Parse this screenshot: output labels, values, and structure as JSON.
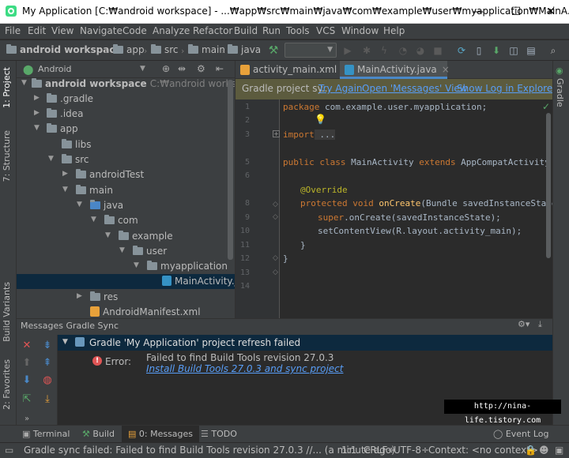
{
  "window": {
    "title": "My Application [C:₩android workspace] - ...₩app₩src₩main₩java₩com₩example₩user₩myapplication₩MainA...",
    "minimize": "—",
    "maximize": "☐",
    "close": "✕"
  },
  "menu": [
    "File",
    "Edit",
    "View",
    "Navigate",
    "Code",
    "Analyze",
    "Refactor",
    "Build",
    "Run",
    "Tools",
    "VCS",
    "Window",
    "Help"
  ],
  "breadcrumb": [
    "android workspace",
    "app",
    "src",
    "main",
    "java"
  ],
  "project_panel": {
    "view_mode": "Android",
    "tree": [
      {
        "label": "android workspace",
        "extra": "C:₩android workspace",
        "arrow": "▼"
      },
      {
        "label": ".gradle",
        "arrow": "▶"
      },
      {
        "label": ".idea",
        "arrow": "▶"
      },
      {
        "label": "app",
        "arrow": "▼"
      },
      {
        "label": "libs",
        "arrow": ""
      },
      {
        "label": "src",
        "arrow": "▼"
      },
      {
        "label": "androidTest",
        "arrow": "▶"
      },
      {
        "label": "main",
        "arrow": "▼"
      },
      {
        "label": "java",
        "arrow": "▼"
      },
      {
        "label": "com",
        "arrow": "▼"
      },
      {
        "label": "example",
        "arrow": "▼"
      },
      {
        "label": "user",
        "arrow": "▼"
      },
      {
        "label": "myapplication",
        "arrow": "▼"
      },
      {
        "label": "MainActivity.java",
        "arrow": ""
      },
      {
        "label": "res",
        "arrow": "▶"
      },
      {
        "label": "AndroidManifest.xml",
        "arrow": ""
      }
    ]
  },
  "left_tabs": {
    "project": "1: Project",
    "structure": "7: Structure",
    "build_variants": "Build Variants",
    "favorites": "2: Favorites"
  },
  "right_tabs": {
    "gradle": "Gradle"
  },
  "editor": {
    "tabs": [
      {
        "label": "activity_main.xml",
        "close": "×"
      },
      {
        "label": "MainActivity.java",
        "close": "×"
      }
    ],
    "notice": {
      "text": "Gradle project sy...",
      "link1": "Try Again",
      "link2": "Open 'Messages' View",
      "link3": "Show Log in Explorer"
    },
    "lines": [
      "1",
      "2",
      "3",
      "5",
      "6",
      "8",
      "9",
      "10",
      "11",
      "12",
      "13",
      "14"
    ],
    "code": {
      "l1_kw": "package",
      "l1_rest": " com.example.user.myapplication;",
      "l3_kw": "import",
      "l3_rest": " ...",
      "l6_kw": "public class",
      "l6_name": " MainActivity ",
      "l6_kw2": "extends",
      "l6_rest": " AppCompatActivity {",
      "l8": "@Override",
      "l9_kw": "protected void",
      "l9_fn": " onCreate",
      "l9_rest": "(Bundle savedInstanceState) {",
      "l10_kw": "super",
      ".": "",
      "l10_fn": ".onCreate",
      "l10_rest": "(savedInstanceState);",
      "l11": "setContentView(R.layout.activity_main);",
      "l12": "}",
      "l13": "}"
    }
  },
  "messages": {
    "header": "Messages Gradle Sync",
    "title": "Gradle 'My Application' project refresh failed",
    "error_label": "Error:",
    "error_text": "Failed to find Build Tools revision 27.0.3",
    "error_link": "Install Build Tools 27.0.3 and sync project"
  },
  "bottom_tabs": [
    "Terminal",
    "Build",
    "0: Messages",
    "TODO",
    "Event Log"
  ],
  "status": {
    "text": "Gradle sync failed: Failed to find Build Tools revision 27.0.3 //... (a minute ago)",
    "pos": "1:1",
    "sep": "CRLF÷",
    "enc": "UTF-8÷",
    "ctx": "Context: <no context>"
  },
  "watermark": "http://nina-life.tistory.com",
  "colors": {
    "accent": "#589df6",
    "error": "#e05555",
    "selection": "#0d293e",
    "notice": "#5c5b3e"
  }
}
